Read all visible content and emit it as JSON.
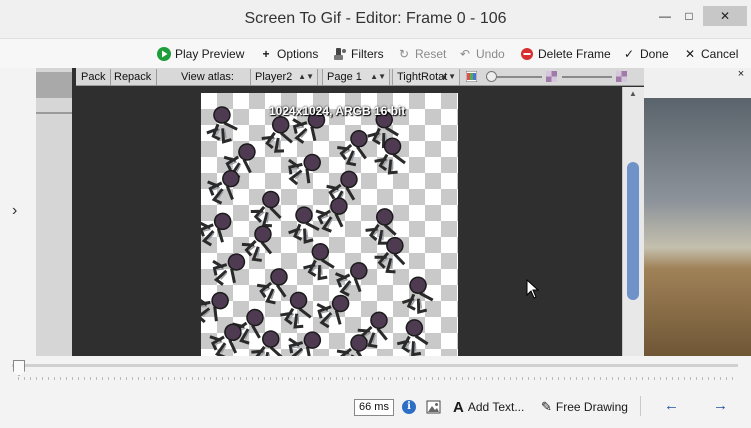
{
  "window": {
    "title": "Screen To Gif - Editor: Frame 0 - 106",
    "minimize": "—",
    "maximize": "□",
    "close": "✕"
  },
  "toolbar": {
    "play_preview": "Play Preview",
    "options": "Options",
    "filters": "Filters",
    "reset": "Reset",
    "undo": "Undo",
    "delete_frame": "Delete Frame",
    "done": "Done",
    "cancel": "Cancel"
  },
  "editor": {
    "pack": "Pack",
    "repack": "Repack",
    "view_atlas_label": "View atlas:",
    "atlas_value": "Player2",
    "page_value": "Page 1",
    "mode_value": "TightRotat",
    "atlas_info": "1024x1024, ARGB 16 bit"
  },
  "right_panel": {
    "close": "×"
  },
  "status": {
    "delay": "66 ms",
    "add_text": "Add Text...",
    "free_drawing": "Free Drawing"
  },
  "colors": {
    "play_green": "#1e9e3a",
    "delete_red": "#d63030",
    "scroll_thumb": "#6f92c8",
    "nav_blue": "#1d4f9f"
  }
}
